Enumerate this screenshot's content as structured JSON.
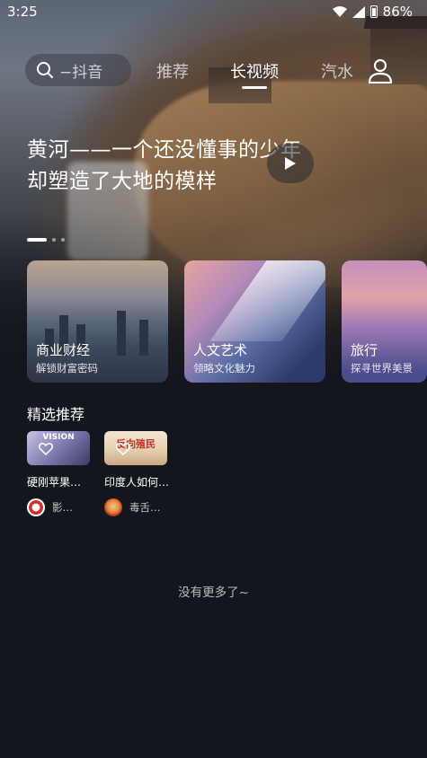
{
  "status": {
    "time": "3:25",
    "battery": "86%"
  },
  "search": {
    "text": "−抖音"
  },
  "tabs": [
    {
      "label": "推荐",
      "active": false
    },
    {
      "label": "长视频",
      "active": true
    },
    {
      "label": "汽水",
      "active": false
    }
  ],
  "hero": {
    "line1": "黄河——一个还没懂事的少年",
    "line2": "却塑造了大地的模样"
  },
  "categories": [
    {
      "title": "商业财经",
      "subtitle": "解锁财富密码"
    },
    {
      "title": "人文艺术",
      "subtitle": "领略文化魅力"
    },
    {
      "title": "旅行",
      "subtitle": "探寻世界美景"
    }
  ],
  "section": {
    "title": "精选推荐"
  },
  "videos": [
    {
      "thumb_text": "VISION",
      "title": "硬刚苹果…",
      "author": "影…"
    },
    {
      "thumb_text": "反向殖民",
      "title": "印度人如何…",
      "author": "毒舌…"
    }
  ],
  "footer": {
    "no_more": "没有更多了~"
  },
  "colors": {
    "background": "#13161d",
    "accent": "#ffffff"
  }
}
